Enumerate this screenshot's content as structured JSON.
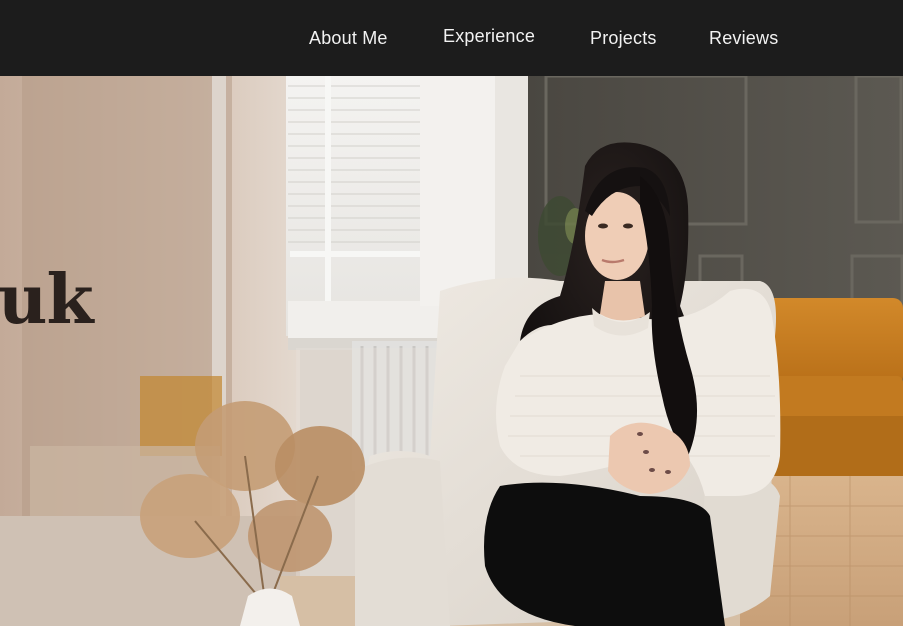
{
  "nav": {
    "items": [
      {
        "label": "About Me"
      },
      {
        "label": "Experience"
      },
      {
        "label": "Projects"
      },
      {
        "label": "Reviews"
      }
    ]
  },
  "hero": {
    "title_fragment": "uk",
    "photo": "woman-in-armchair-photo"
  },
  "colors": {
    "navbar_bg": "#1c1c1c",
    "nav_text": "#f2f2f2",
    "wall_dark": "#55524c",
    "sofa_orange": "#c9801f",
    "title_text": "#2a211d"
  }
}
